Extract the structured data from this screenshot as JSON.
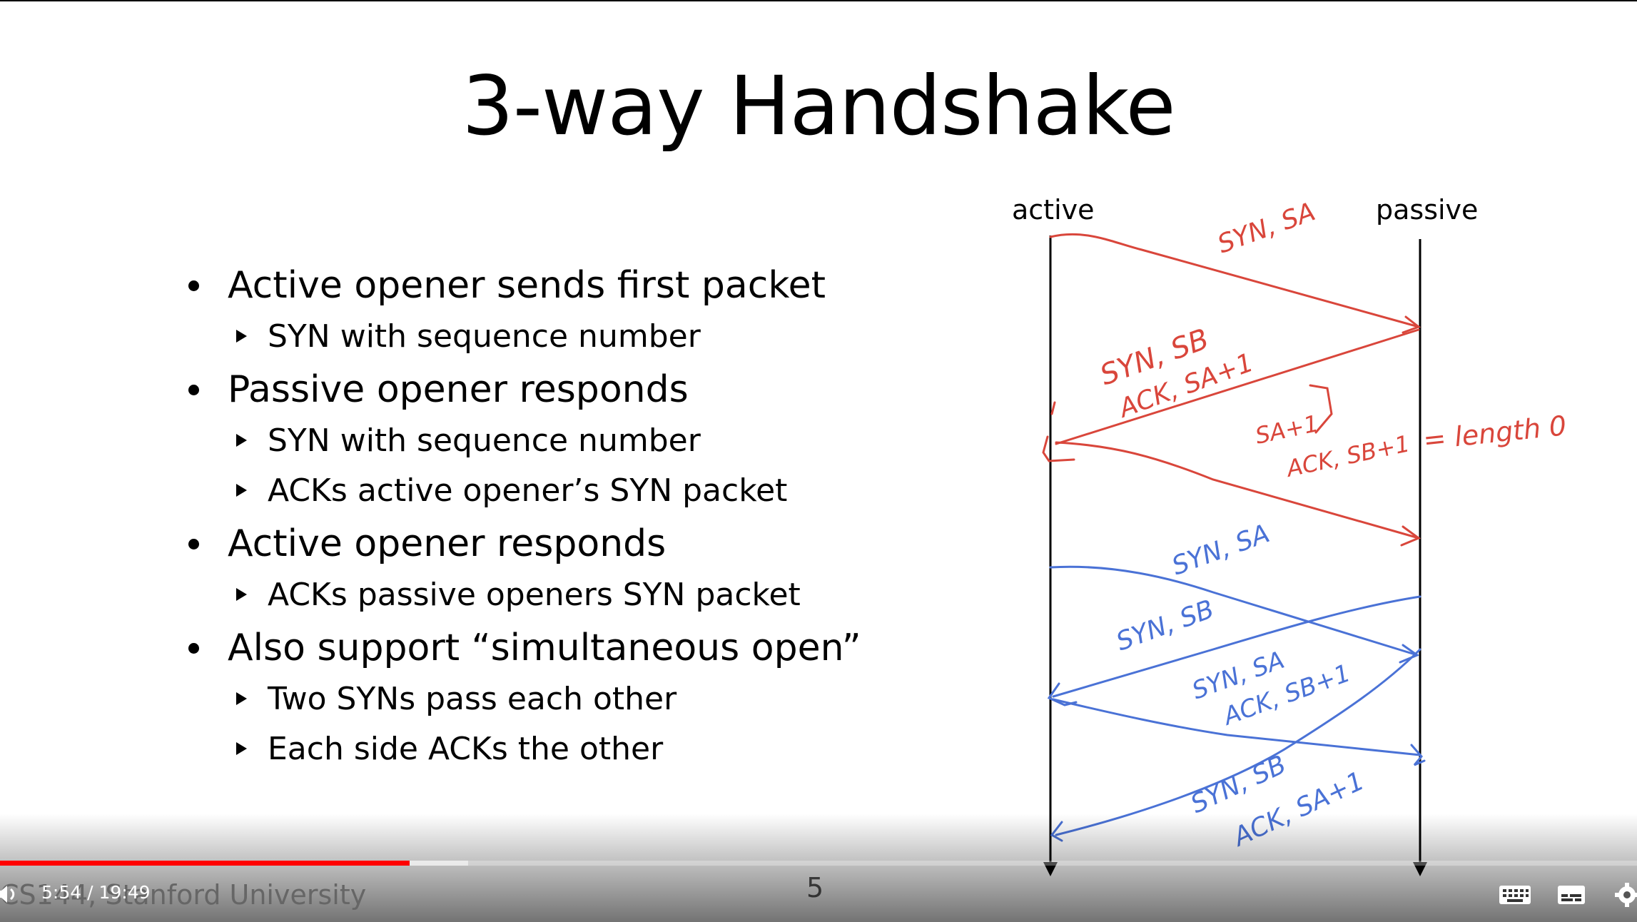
{
  "slide": {
    "title": "3-way Handshake",
    "bullets": [
      {
        "text": "Active opener sends first packet",
        "sub": [
          "SYN with sequence number"
        ]
      },
      {
        "text": "Passive opener responds",
        "sub": [
          "SYN with sequence number",
          "ACKs active opener’s SYN packet"
        ]
      },
      {
        "text": "Active opener responds",
        "sub": [
          "ACKs passive openers SYN packet"
        ]
      },
      {
        "text": "Also support “simultaneous open”",
        "sub": [
          "Two SYNs pass each other",
          "Each side ACKs the other"
        ]
      }
    ],
    "diagram": {
      "left_label": "active",
      "right_label": "passive",
      "annotations_red": [
        "SYN, SA",
        "SYN, SB",
        "ACK, SA+1",
        "SA+1",
        "ACK, SB+1",
        "= length 0"
      ],
      "annotations_blue": [
        "SYN, SA",
        "SYN, SB",
        "SYN, SA",
        "ACK, SB+1",
        "SYN, SB",
        "ACK, SA+1"
      ],
      "red_color": "#d9463b",
      "blue_color": "#4a72d6"
    },
    "slide_number": "5",
    "credit": "CS144, Stanford University"
  },
  "player": {
    "time_display": "5:54 / 19:49",
    "progress": 0.25,
    "buffered": 0.286,
    "progress_color": "#ff0000",
    "icons": [
      "volume-icon",
      "keyboard-icon",
      "subtitles-icon",
      "settings-icon"
    ]
  }
}
